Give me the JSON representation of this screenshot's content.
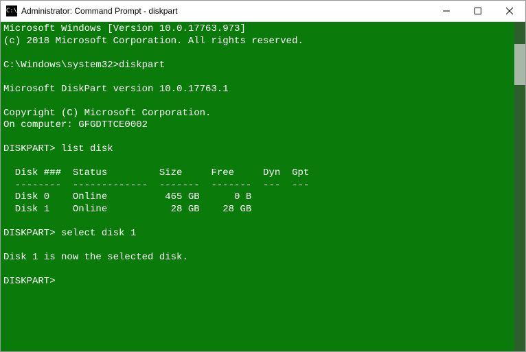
{
  "window": {
    "title": "Administrator: Command Prompt - diskpart",
    "icon_text": "C:\\"
  },
  "terminal": {
    "lines": [
      "Microsoft Windows [Version 10.0.17763.973]",
      "(c) 2018 Microsoft Corporation. All rights reserved.",
      "",
      "C:\\Windows\\system32>diskpart",
      "",
      "Microsoft DiskPart version 10.0.17763.1",
      "",
      "Copyright (C) Microsoft Corporation.",
      "On computer: GFGDTTCE0002",
      "",
      "DISKPART> list disk",
      "",
      "  Disk ###  Status         Size     Free     Dyn  Gpt",
      "  --------  -------------  -------  -------  ---  ---",
      "  Disk 0    Online          465 GB      0 B",
      "  Disk 1    Online           28 GB    28 GB",
      "",
      "DISKPART> select disk 1",
      "",
      "Disk 1 is now the selected disk.",
      "",
      "DISKPART>"
    ]
  }
}
